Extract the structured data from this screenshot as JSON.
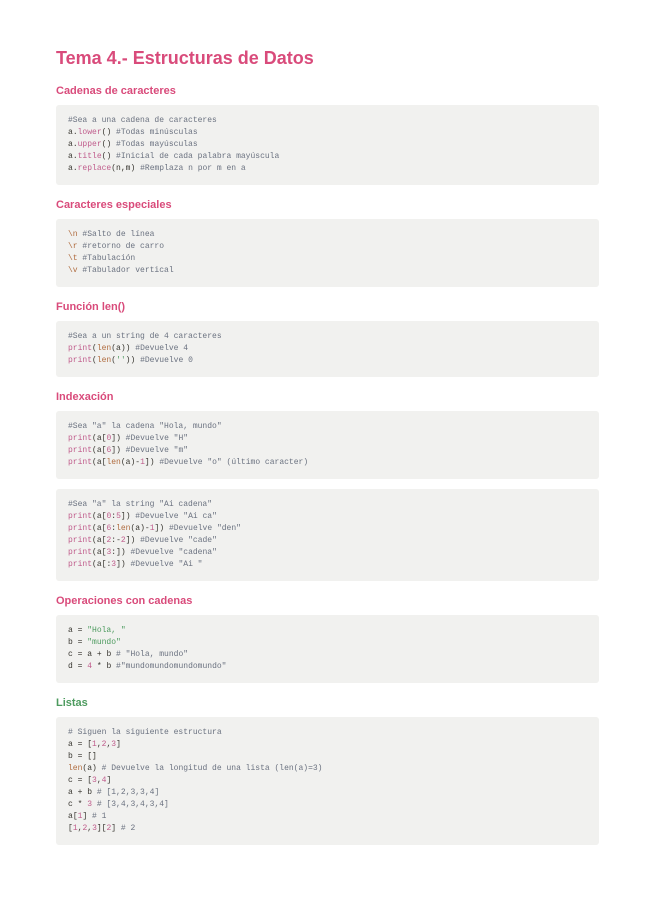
{
  "title": "Tema 4.- Estructuras de Datos",
  "sections": {
    "cadenas": {
      "heading": "Cadenas de caracteres"
    },
    "especiales": {
      "heading": "Caracteres especiales"
    },
    "len": {
      "heading": "Función len()"
    },
    "index": {
      "heading": "Indexación"
    },
    "ops": {
      "heading": "Operaciones con cadenas"
    },
    "listas": {
      "heading": "Listas"
    }
  },
  "code": {
    "cadenas": {
      "l1": "#Sea a una cadena de caracteres",
      "l2a": "a",
      "l2b": ".",
      "l2c": "lower",
      "l2d": "() ",
      "l2e": "#Todas minúsculas",
      "l3a": "a",
      "l3b": ".",
      "l3c": "upper",
      "l3d": "() ",
      "l3e": "#Todas mayúsculas",
      "l4a": "a",
      "l4b": ".",
      "l4c": "title",
      "l4d": "() ",
      "l4e": "#Inicial de cada palabra mayúscula",
      "l5a": "a",
      "l5b": ".",
      "l5c": "replace",
      "l5d": "(",
      "l5e": "n",
      "l5f": ",",
      "l5g": "m",
      "l5h": ") ",
      "l5i": "#Remplaza n por m en a"
    },
    "especiales": {
      "l1a": "\\n",
      "l1b": " #Salto de línea",
      "l2a": "\\r",
      "l2b": " #retorno de carro",
      "l3a": "\\t",
      "l3b": " #Tabulación",
      "l4a": "\\v",
      "l4b": " #Tabulador vertical"
    },
    "len": {
      "l1": "#Sea a un string de 4 caracteres",
      "l2a": "print",
      "l2b": "(",
      "l2c": "len",
      "l2d": "(",
      "l2e": "a",
      "l2f": ")) ",
      "l2g": "#Devuelve 4",
      "l3a": "print",
      "l3b": "(",
      "l3c": "len",
      "l3d": "(",
      "l3e": "''",
      "l3f": ")) ",
      "l3g": "#Devuelve 0"
    },
    "index1": {
      "l1": "#Sea \"a\" la cadena \"Hola, mundo\"",
      "l2a": "print",
      "l2b": "(",
      "l2c": "a",
      "l2d": "[",
      "l2e": "0",
      "l2f": "]) ",
      "l2g": "#Devuelve \"H\"",
      "l3a": "print",
      "l3b": "(",
      "l3c": "a",
      "l3d": "[",
      "l3e": "6",
      "l3f": "]) ",
      "l3g": "#Devuelve \"m\"",
      "l4a": "print",
      "l4b": "(",
      "l4c": "a",
      "l4d": "[",
      "l4e": "len",
      "l4f": "(",
      "l4g": "a",
      "l4h": ")-",
      "l4i": "1",
      "l4j": "]) ",
      "l4k": "#Devuelve \"o\" (último caracter)"
    },
    "index2": {
      "l1": "#Sea \"a\" la string \"Ai cadena\"",
      "l2a": "print",
      "l2b": "(",
      "l2c": "a",
      "l2d": "[",
      "l2e": "0",
      "l2f": ":",
      "l2g": "5",
      "l2h": "]) ",
      "l2i": "#Devuelve \"Ai ca\"",
      "l3a": "print",
      "l3b": "(",
      "l3c": "a",
      "l3d": "[",
      "l3e": "6",
      "l3f": ":",
      "l3g": "len",
      "l3h": "(",
      "l3i": "a",
      "l3j": ")-",
      "l3k": "1",
      "l3l": "]) ",
      "l3m": "#Devuelve \"den\"",
      "l4a": "print",
      "l4b": "(",
      "l4c": "a",
      "l4d": "[",
      "l4e": "2",
      "l4f": ":-",
      "l4g": "2",
      "l4h": "]) ",
      "l4i": "#Devuelve \"cade\"",
      "l5a": "print",
      "l5b": "(",
      "l5c": "a",
      "l5d": "[",
      "l5e": "3",
      "l5f": ":]) ",
      "l5g": "#Devuelve \"cadena\"",
      "l6a": "print",
      "l6b": "(",
      "l6c": "a",
      "l6d": "[:",
      "l6e": "3",
      "l6f": "]) ",
      "l6g": "#Devuelve \"Ai \""
    },
    "ops": {
      "l1a": "a",
      "l1b": " = ",
      "l1c": "\"Hola, \"",
      "l2a": "b",
      "l2b": " = ",
      "l2c": "\"mundo\"",
      "l3a": "c",
      "l3b": " = ",
      "l3c": "a",
      "l3d": " + ",
      "l3e": "b",
      "l3f": " # \"Hola, mundo\"",
      "l4a": "d",
      "l4b": " = ",
      "l4c": "4",
      "l4d": " * ",
      "l4e": "b",
      "l4f": " #\"mundomundomundomundo\""
    },
    "listas": {
      "l1": "# Siguen la siguiente estructura",
      "l2a": "a",
      "l2b": " = [",
      "l2c": "1",
      "l2d": ",",
      "l2e": "2",
      "l2f": ",",
      "l2g": "3",
      "l2h": "]",
      "l3a": "b",
      "l3b": " = []",
      "l4a": "len",
      "l4b": "(",
      "l4c": "a",
      "l4d": ") ",
      "l4e": "# Devuelve la longitud de una lista (len(a)=3)",
      "l5a": "c",
      "l5b": " = [",
      "l5c": "3",
      "l5d": ",",
      "l5e": "4",
      "l5f": "]",
      "l6a": "a",
      "l6b": " + ",
      "l6c": "b",
      "l6d": " # [1,2,3,3,4]",
      "l7a": "c",
      "l7b": " * ",
      "l7c": "3",
      "l7d": " # [3,4,3,4,3,4]",
      "l8a": "a",
      "l8b": "[",
      "l8c": "1",
      "l8d": "] ",
      "l8e": "# 1",
      "l9a": "[",
      "l9b": "1",
      "l9c": ",",
      "l9d": "2",
      "l9e": ",",
      "l9f": "3",
      "l9g": "][",
      "l9h": "2",
      "l9i": "] ",
      "l9j": "# 2"
    }
  }
}
